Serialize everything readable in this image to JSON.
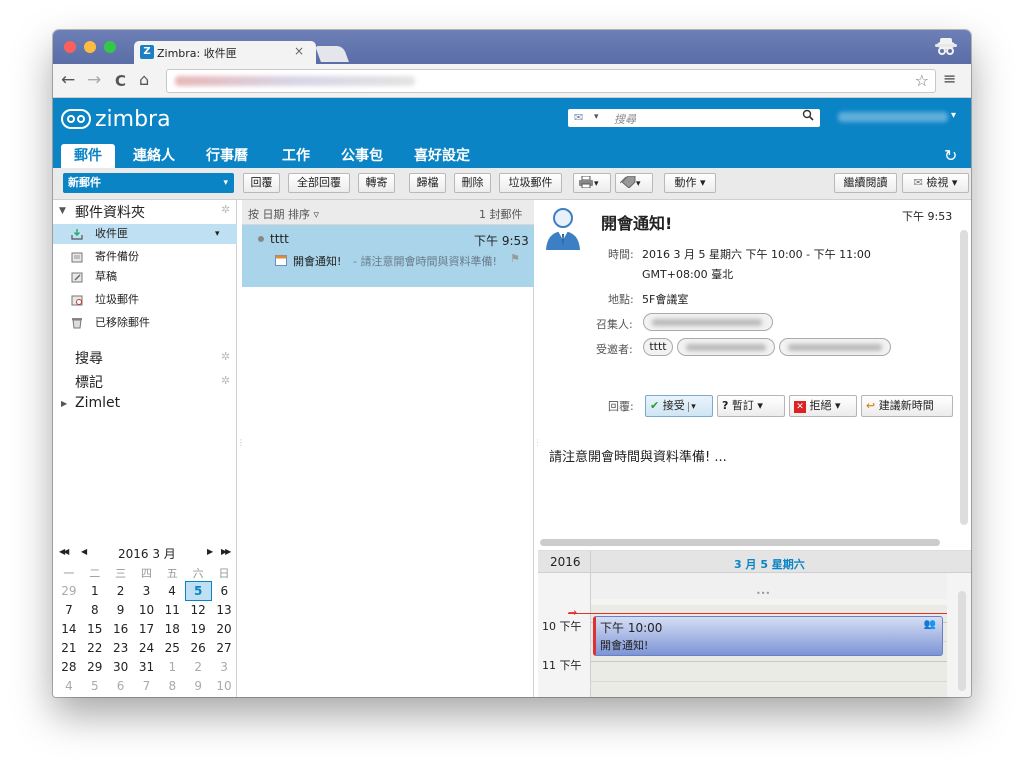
{
  "browser": {
    "tab_title": "Zimbra: 收件匣",
    "tab_close": "×",
    "nav_back": "←",
    "nav_forward": "→",
    "nav_reload": "C",
    "nav_home": "⌂",
    "bookmark_star": "☆",
    "menu_icon": "≡",
    "traffic_colors": [
      "#fc605c",
      "#fdbc40",
      "#34c84a"
    ]
  },
  "app": {
    "logo_text": "zimbra",
    "search_placeholder": "搜尋",
    "search_dropdown": "▾",
    "search_icon": "🔍",
    "user_dropdown": "▾",
    "refresh_icon": "↻",
    "tabs": [
      {
        "label": "郵件"
      },
      {
        "label": "連絡人"
      },
      {
        "label": "行事曆"
      },
      {
        "label": "工作"
      },
      {
        "label": "公事包"
      },
      {
        "label": "喜好設定"
      }
    ],
    "accent": "#0b84c6"
  },
  "actions": {
    "new_mail": "新郵件",
    "new_mail_dd": "▾",
    "reply": "回覆",
    "reply_all": "全部回覆",
    "forward": "轉寄",
    "archive": "歸檔",
    "delete": "刪除",
    "junk": "垃圾郵件",
    "print_dd": "▾",
    "tag_dd": "▾",
    "more": "動作 ▾",
    "continue_reading": "繼續閱讀",
    "view": "檢視 ▾"
  },
  "folders": {
    "header": "郵件資料夾",
    "header_arrow": "▼",
    "items": [
      {
        "label": "收件匣",
        "selected": true
      },
      {
        "label": "寄件備份"
      },
      {
        "label": "草稿"
      },
      {
        "label": "垃圾郵件"
      },
      {
        "label": "已移除郵件"
      }
    ],
    "inbox_dd": "▾",
    "search": "搜尋",
    "tags": "標記",
    "zimlet": "Zimlet",
    "zimlet_arrow": "▶"
  },
  "mini_cal": {
    "nav_prev2": "◀◀",
    "nav_prev": "◀",
    "title": "2016 3 月",
    "nav_next": "▶",
    "nav_next2": "▶▶",
    "dow": [
      "一",
      "二",
      "三",
      "四",
      "五",
      "六",
      "日"
    ],
    "weeks": [
      [
        "29",
        "1",
        "2",
        "3",
        "4",
        "5",
        "6"
      ],
      [
        "7",
        "8",
        "9",
        "10",
        "11",
        "12",
        "13"
      ],
      [
        "14",
        "15",
        "16",
        "17",
        "18",
        "19",
        "20"
      ],
      [
        "21",
        "22",
        "23",
        "24",
        "25",
        "26",
        "27"
      ],
      [
        "28",
        "29",
        "30",
        "31",
        "1",
        "2",
        "3"
      ],
      [
        "4",
        "5",
        "6",
        "7",
        "8",
        "9",
        "10"
      ]
    ]
  },
  "list": {
    "sort_label": "按 日期 排序 ▿",
    "count": "1 封郵件",
    "messages": [
      {
        "sender": "tttt",
        "time": "下午 9:53",
        "subject": "開會通知!",
        "preview": " - 請注意開會時間與資料準備!"
      }
    ]
  },
  "reading": {
    "subject": "開會通知!",
    "time": "下午 9:53",
    "time_label": "時間:",
    "time_value_1": "2016 3 月 5 星期六 下午 10:00 - 下午 11:00",
    "time_value_2": "GMT+08:00 臺北",
    "location_label": "地點:",
    "location_value": "5F會議室",
    "organizer_label": "召集人:",
    "invitees_label": "受邀者:",
    "invitee_1": "tttt",
    "reply_label": "回覆:",
    "accept": "接受",
    "tentative": "暫訂 ▾",
    "decline": "拒絕 ▾",
    "propose": "建議新時間",
    "body": "請注意開會時間與資料準備! ..."
  },
  "day_view": {
    "year": "2016",
    "date_header": "3 月 5 星期六",
    "hour_10": "10 下午",
    "hour_11": "11 下午",
    "appt_time": "下午 10:00",
    "appt_title": "開會通知!"
  }
}
